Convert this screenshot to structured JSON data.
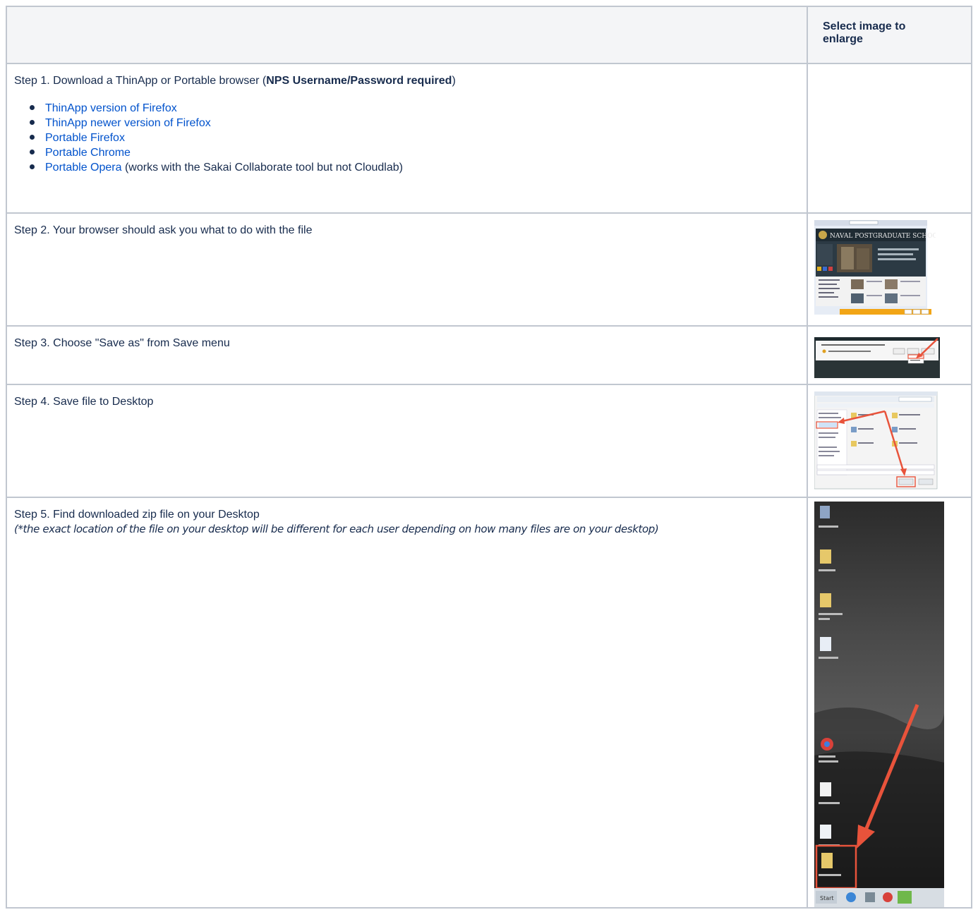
{
  "table": {
    "header": {
      "step_column": "",
      "image_column": "Select image to enlarge"
    },
    "step1": {
      "prefix": "Step 1. Download a ThinApp or Portable browser (",
      "bold": "NPS Username/Password required",
      "suffix": ")",
      "links": [
        {
          "text": "ThinApp version of Firefox",
          "after": ""
        },
        {
          "text": "ThinApp newer version of Firefox",
          "after": ""
        },
        {
          "text": "Portable Firefox",
          "after": ""
        },
        {
          "text": "Portable Chrome",
          "after": ""
        },
        {
          "text": "Portable Opera",
          "after": " (works with the Sakai Collaborate tool but not Cloudlab)"
        }
      ]
    },
    "step2": {
      "text": "Step 2. Your browser should ask you what to do with the file"
    },
    "step3": {
      "text": "Step 3. Choose \"Save as\" from Save menu"
    },
    "step4": {
      "text": "Step 4. Save file to Desktop"
    },
    "step5": {
      "text": "Step 5. Find downloaded zip file on your Desktop",
      "note": "(*the exact location of the file on your desktop will be different for each user depending on how many files are on your desktop)"
    }
  },
  "thumbnails": {
    "step2": {
      "banner_text": "NAVAL POSTGRADUATE SCHOOL"
    },
    "step5": {
      "start_label": "Start"
    }
  },
  "colors": {
    "link": "#0052cc",
    "border": "#c1c7d0",
    "header_bg": "#f4f5f7",
    "arrow": "#e8533b"
  }
}
